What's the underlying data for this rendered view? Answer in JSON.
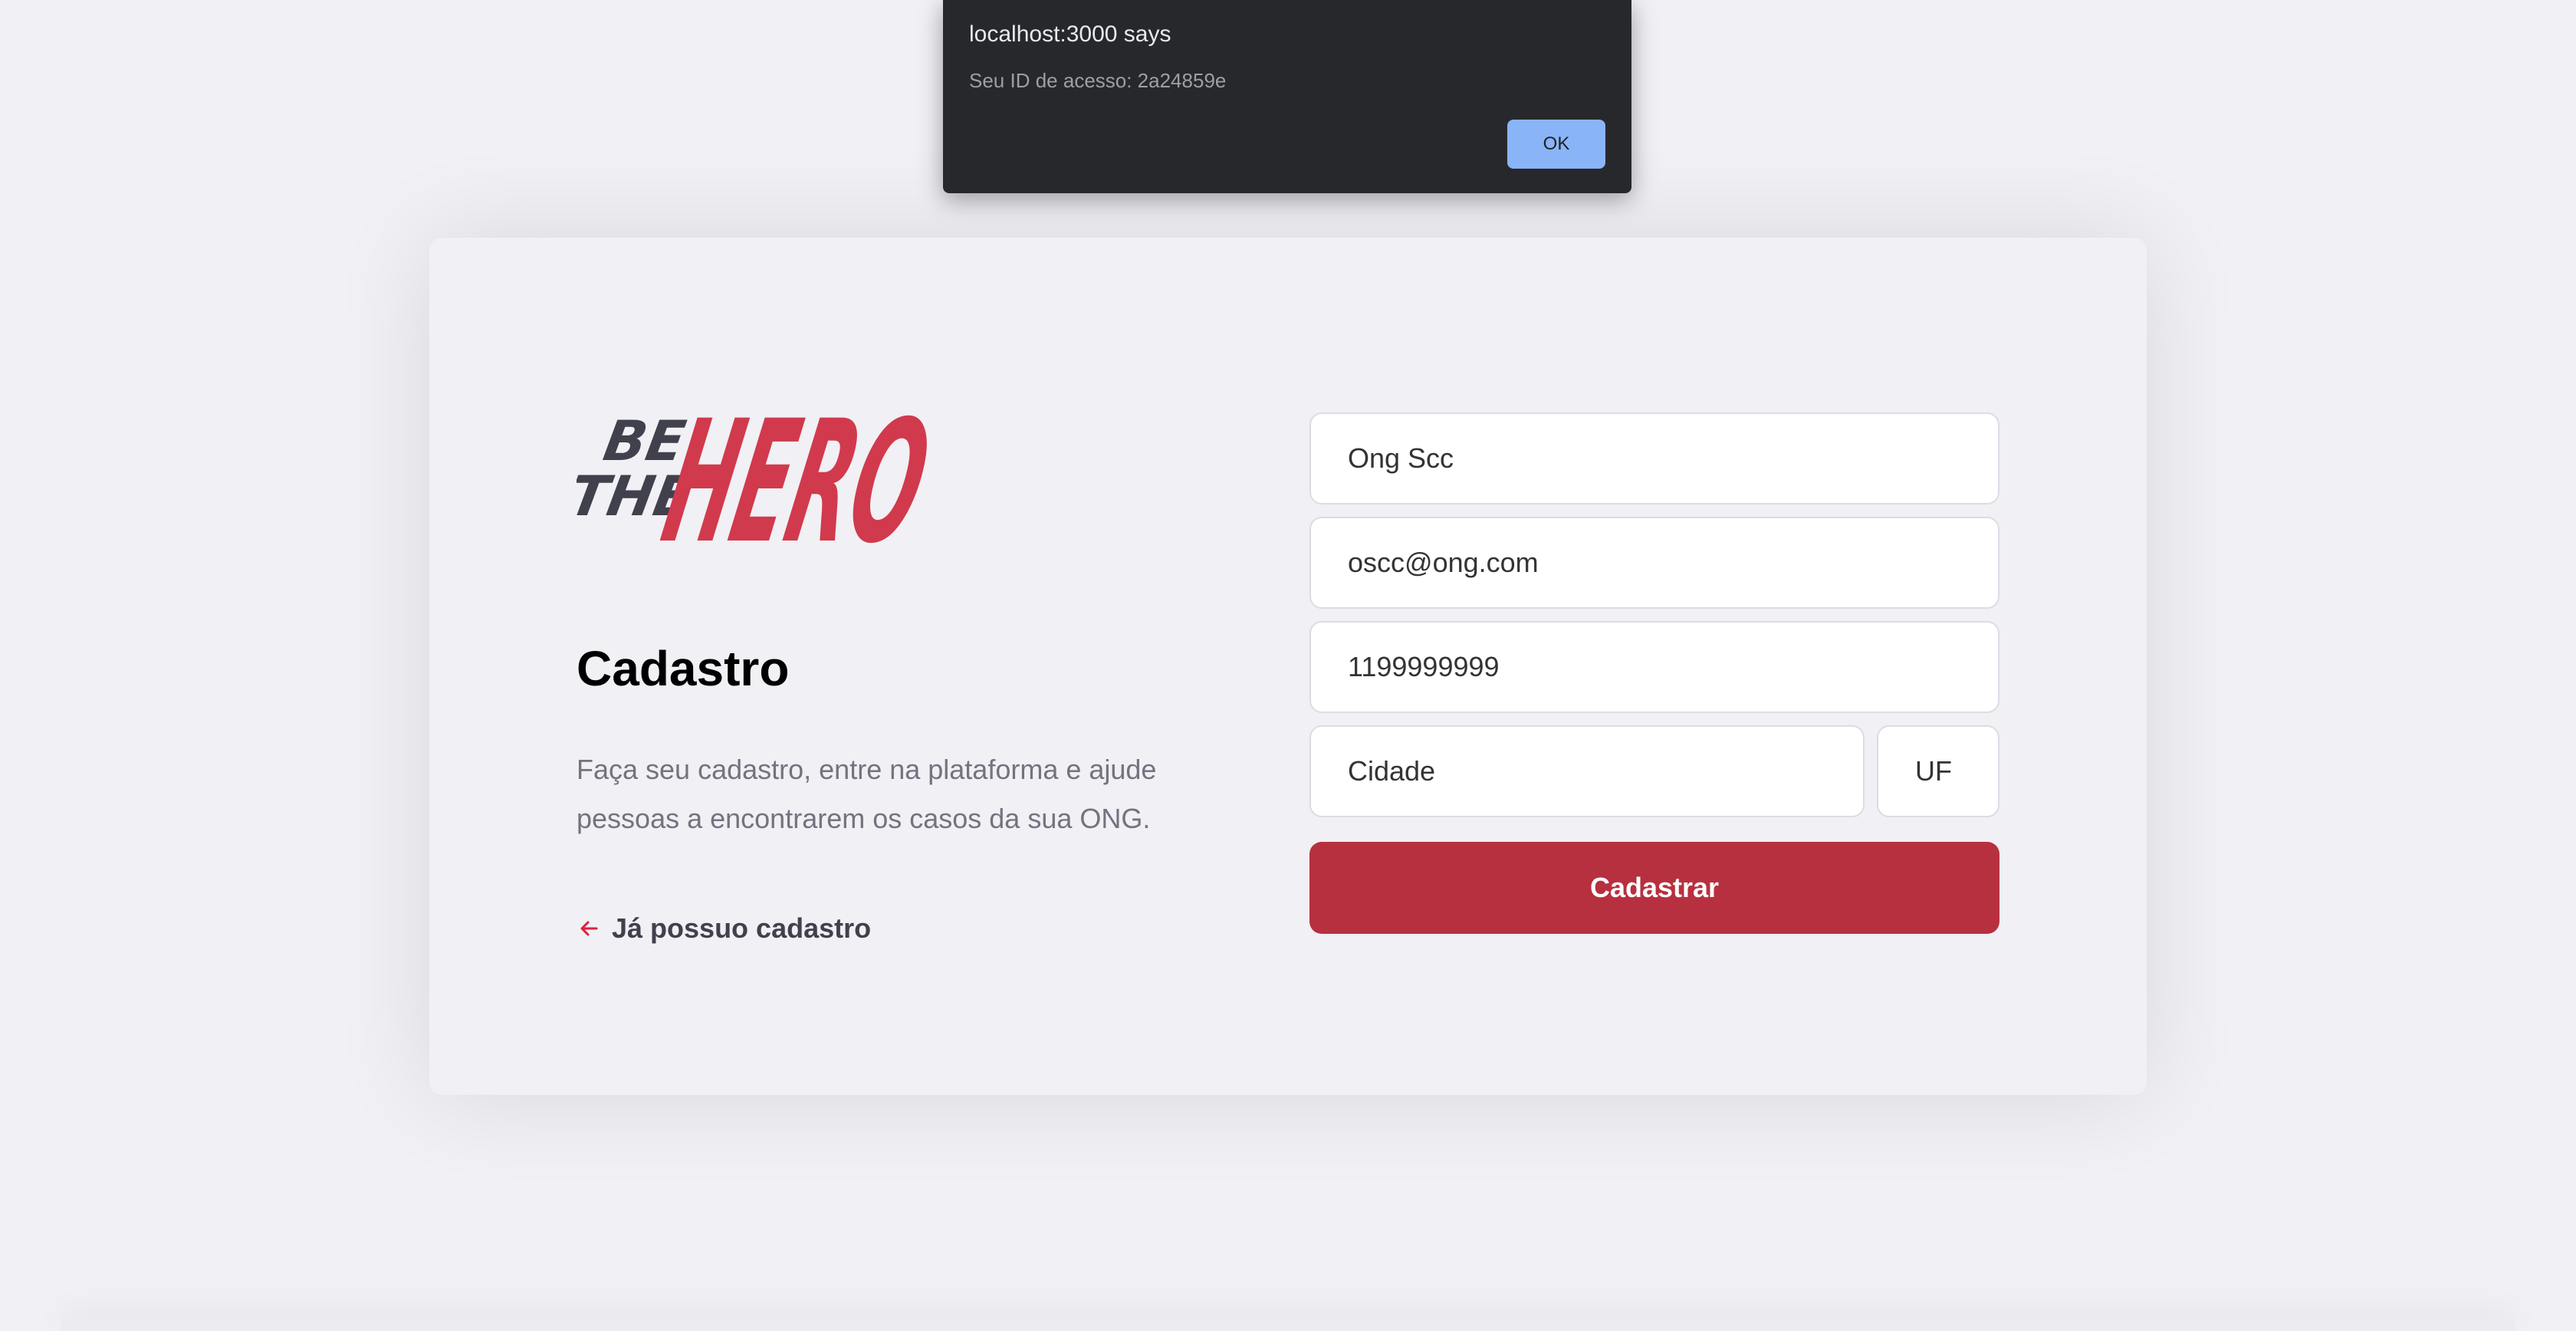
{
  "logo": {
    "be": "BE",
    "the": "THE",
    "hero": "HERO"
  },
  "register": {
    "title": "Cadastro",
    "description_line1": "Faça seu cadastro, entre na plataforma e ajude",
    "description_line2": "pessoas a encontrarem os casos da sua ONG.",
    "back_link": "Já possuo cadastro",
    "back_icon": "arrow-left-icon"
  },
  "form": {
    "name_value": "Ong Scc",
    "email_value": "oscc@ong.com",
    "whatsapp_value": "1199999999",
    "city_placeholder": "Cidade",
    "uf_placeholder": "UF",
    "submit_label": "Cadastrar"
  },
  "alert": {
    "title": "localhost:3000 says",
    "message": "Seu ID de acesso: 2a24859e",
    "ok_label": "OK"
  },
  "colors": {
    "brand_red": "#e02041",
    "button_red": "#b7303f",
    "background": "#f0f0f5",
    "dialog_bg": "#27282c",
    "dialog_button": "#8ab4f8"
  }
}
